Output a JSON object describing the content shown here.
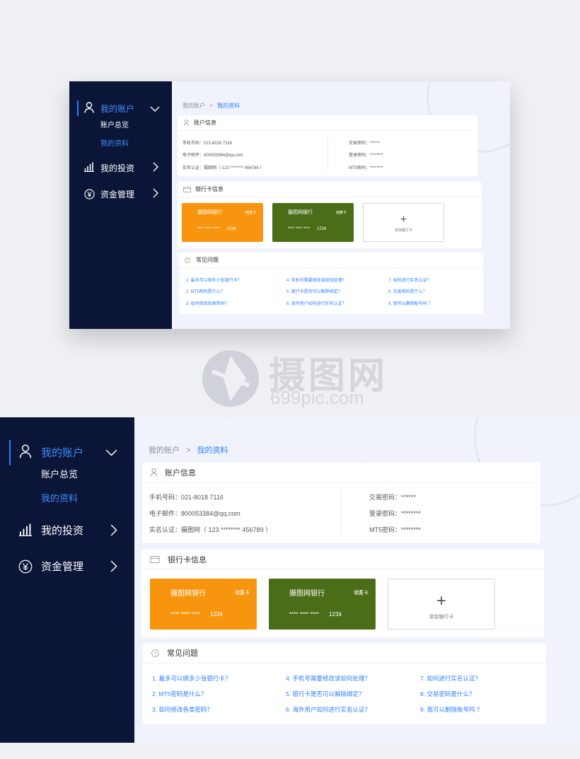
{
  "nav": {
    "account": "我的账户",
    "overview": "账户总览",
    "profile": "我的资料",
    "invest": "我的投资",
    "funds": "资金管理"
  },
  "breadcrumb": {
    "root": "我的账户",
    "sep": ">",
    "current": "我的资料"
  },
  "account_info": {
    "title": "账户信息",
    "phone": "手机号码：021-8018 7116",
    "email": "电子邮件：800053384@qq.com",
    "realname": "实名认证：摄图网（ 123 ******** 456789 ）",
    "trade_pwd": "交易密码：******",
    "login_pwd": "登录密码：********",
    "mt5_pwd": "MT5密码：********"
  },
  "bank_info": {
    "title": "银行卡信息",
    "cards": [
      {
        "bank": "摄图网银行",
        "type": "储蓄卡",
        "masked": "****  ****  ****",
        "last4": "1234",
        "color": "#f7960e"
      },
      {
        "bank": "摄图网银行",
        "type": "储蓄卡",
        "masked": "****  ****  ****",
        "last4": "1234",
        "color": "#4a6e17"
      }
    ],
    "add_label": "添加银行卡"
  },
  "faq": {
    "title": "常见问题",
    "items": [
      "1. 最多可以绑多少张银行卡？",
      "2. MT5密码是什么？",
      "3. 如何修改各类密码？",
      "4. 手机号需要修改该如何处理？",
      "5. 银行卡是否可以解除绑定？",
      "6. 海外用户如何进行实名认证？",
      "7. 如何进行实名认证？",
      "8. 交易密码是什么？",
      "9. 我可以删除账号吗 ？"
    ]
  },
  "watermark": {
    "brand": "摄图网",
    "url": "699pic.com"
  },
  "colors": {
    "sidebar": "#0b1538",
    "accent": "#2f7fff",
    "background": "#f0f3fb"
  },
  "icons": {
    "user": "user-icon",
    "chart": "bar-chart-icon",
    "yen": "yen-icon",
    "chev_down": "chevron-down-icon",
    "chev_right": "chevron-right-icon",
    "card": "card-icon",
    "question": "question-icon",
    "plus": "plus-icon"
  }
}
